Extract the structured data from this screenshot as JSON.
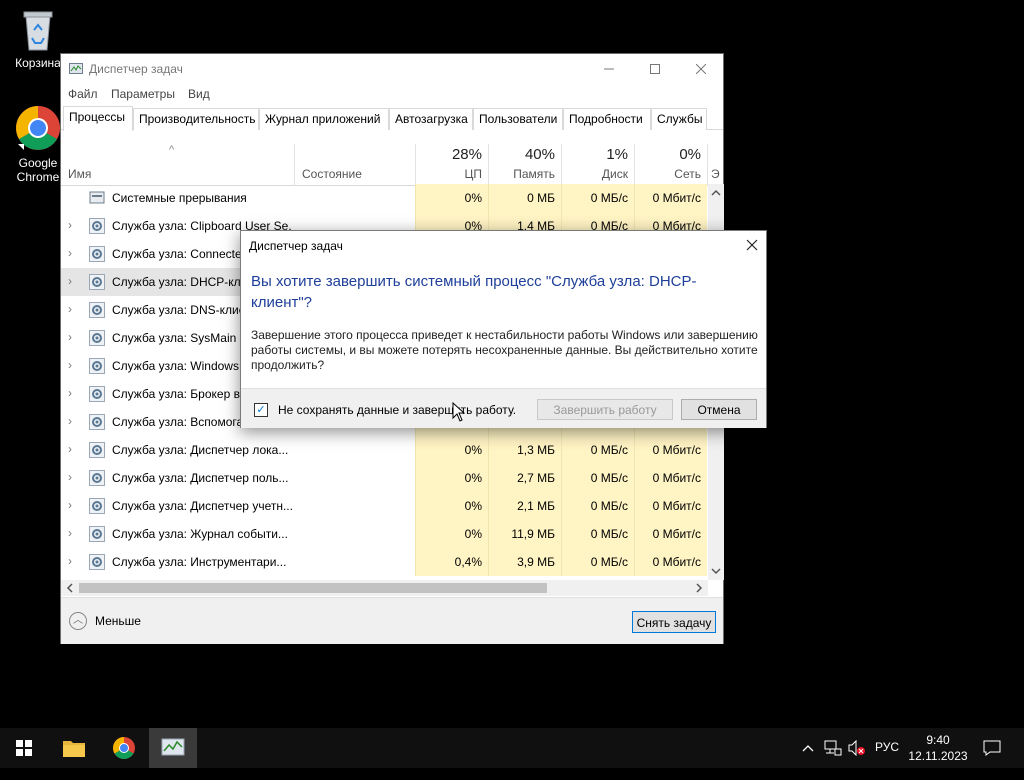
{
  "desktop": {
    "icons": [
      {
        "label": "Корзина",
        "icon": "recycle-bin-icon"
      },
      {
        "label": "Google Chrome",
        "icon": "chrome-icon"
      }
    ]
  },
  "window": {
    "title": "Диспетчер задач",
    "menu": [
      "Файл",
      "Параметры",
      "Вид"
    ],
    "tabs": [
      "Процессы",
      "Производительность",
      "Журнал приложений",
      "Автозагрузка",
      "Пользователи",
      "Подробности",
      "Службы"
    ],
    "columns": {
      "name": "Имя",
      "state": "Состояние",
      "cpu": {
        "pct": "28%",
        "label": "ЦП"
      },
      "mem": {
        "pct": "40%",
        "label": "Память"
      },
      "disk": {
        "pct": "1%",
        "label": "Диск"
      },
      "net": {
        "pct": "0%",
        "label": "Сеть"
      },
      "extra": "Э"
    },
    "rows": [
      {
        "name": "Системные прерывания",
        "cpu": "0%",
        "mem": "0 МБ",
        "disk": "0 МБ/с",
        "net": "0 Мбит/с"
      },
      {
        "name": "Служба узла: Clipboard User Se...",
        "cpu": "0%",
        "mem": "1,4 МБ",
        "disk": "0 МБ/с",
        "net": "0 Мбит/с"
      },
      {
        "name": "Служба узла: Connecte",
        "cpu": "",
        "mem": "",
        "disk": "",
        "net": ""
      },
      {
        "name": "Служба узла: DHCP-кли",
        "cpu": "",
        "mem": "",
        "disk": "",
        "net": ""
      },
      {
        "name": "Служба узла: DNS-клие",
        "cpu": "",
        "mem": "",
        "disk": "",
        "net": ""
      },
      {
        "name": "Служба узла: SysMain",
        "cpu": "",
        "mem": "",
        "disk": "",
        "net": ""
      },
      {
        "name": "Служба узла: Windows",
        "cpu": "",
        "mem": "",
        "disk": "",
        "net": ""
      },
      {
        "name": "Служба узла: Брокер вр",
        "cpu": "",
        "mem": "",
        "disk": "",
        "net": ""
      },
      {
        "name": "Служба узла: Вспомога",
        "cpu": "",
        "mem": "",
        "disk": "",
        "net": ""
      },
      {
        "name": "Служба узла: Диспетчер лока...",
        "cpu": "0%",
        "mem": "1,3 МБ",
        "disk": "0 МБ/с",
        "net": "0 Мбит/с"
      },
      {
        "name": "Служба узла: Диспетчер поль...",
        "cpu": "0%",
        "mem": "2,7 МБ",
        "disk": "0 МБ/с",
        "net": "0 Мбит/с"
      },
      {
        "name": "Служба узла: Диспетчер учетн...",
        "cpu": "0%",
        "mem": "2,1 МБ",
        "disk": "0 МБ/с",
        "net": "0 Мбит/с"
      },
      {
        "name": "Служба узла: Журнал событи...",
        "cpu": "0%",
        "mem": "11,9 МБ",
        "disk": "0 МБ/с",
        "net": "0 Мбит/с"
      },
      {
        "name": "Служба узла: Инструментари...",
        "cpu": "0,4%",
        "mem": "3,9 МБ",
        "disk": "0 МБ/с",
        "net": "0 Мбит/с"
      }
    ],
    "footer": {
      "less": "Меньше",
      "end_task": "Снять задачу"
    }
  },
  "dialog": {
    "title": "Диспетчер задач",
    "heading": "Вы хотите завершить системный процесс \"Служба узла: DHCP-клиент\"?",
    "body": "Завершение этого процесса приведет к нестабильности работы Windows или завершению работы системы, и вы можете потерять несохраненные данные. Вы действительно хотите продолжить?",
    "checkbox_label": "Не сохранять данные и завершить работу.",
    "checkbox_checked": true,
    "end_button": "Завершить работу",
    "cancel_button": "Отмена"
  },
  "taskbar": {
    "language": "РУС",
    "time": "9:40",
    "date": "12.11.2023"
  }
}
